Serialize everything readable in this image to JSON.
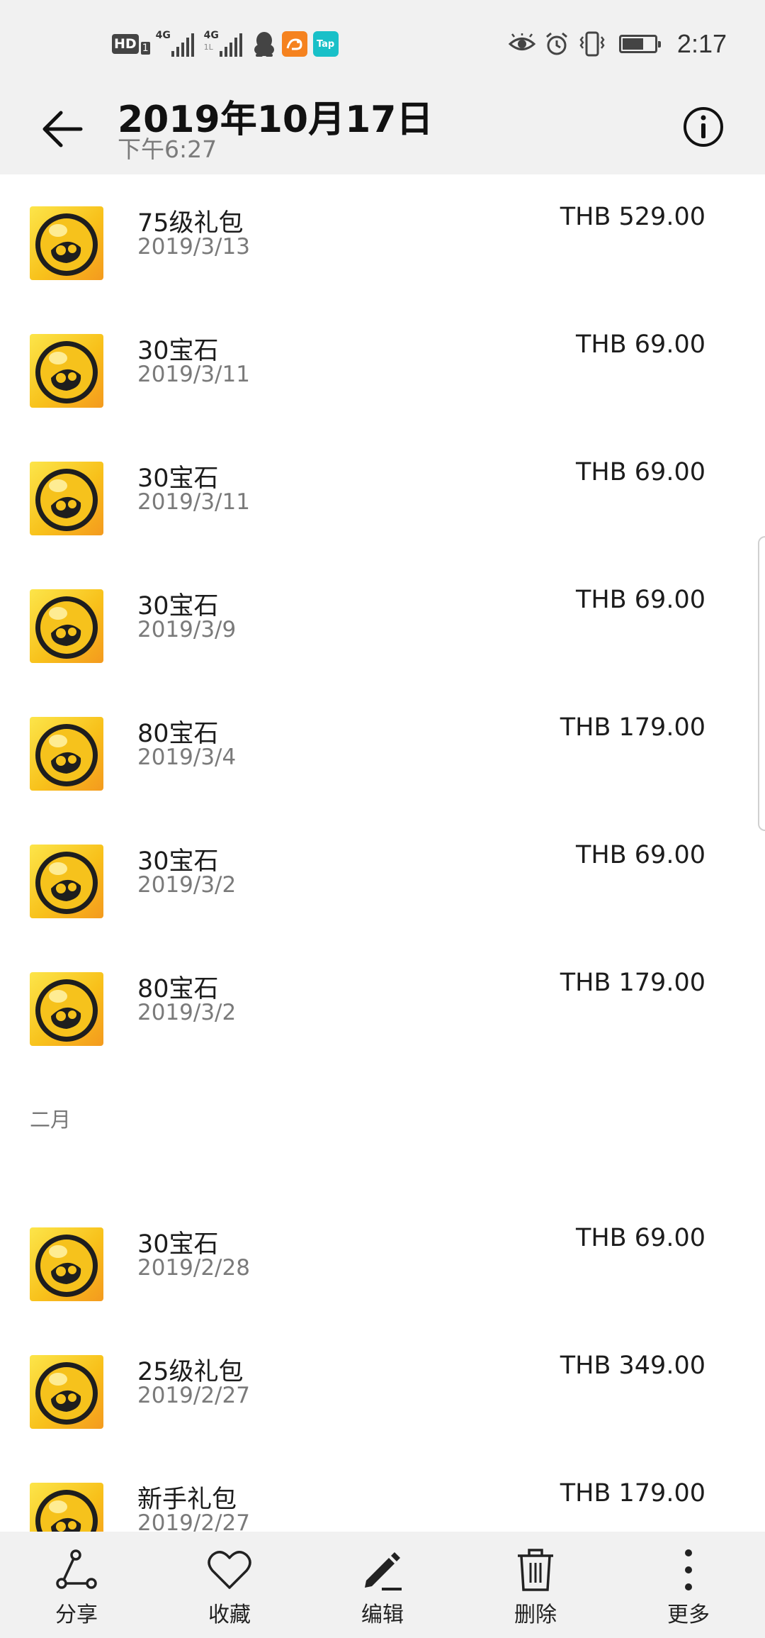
{
  "status_bar": {
    "hd_label": "HD",
    "hd_sub": "1",
    "signal_1_label": "4G",
    "signal_2_label": "4G",
    "signal_2_sub": "1L",
    "tap_app_label": "Tap",
    "time": "2:17"
  },
  "app_bar": {
    "title": "2019年10月17日",
    "subtitle": "下午6:27"
  },
  "list": {
    "items": [
      {
        "name": "75级礼包",
        "date": "2019/3/13",
        "price": "THB 529.00"
      },
      {
        "name": "30宝石",
        "date": "2019/3/11",
        "price": "THB 69.00"
      },
      {
        "name": "30宝石",
        "date": "2019/3/11",
        "price": "THB 69.00"
      },
      {
        "name": "30宝石",
        "date": "2019/3/9",
        "price": "THB 69.00"
      },
      {
        "name": "80宝石",
        "date": "2019/3/4",
        "price": "THB 179.00"
      },
      {
        "name": "30宝石",
        "date": "2019/3/2",
        "price": "THB 69.00"
      },
      {
        "name": "80宝石",
        "date": "2019/3/2",
        "price": "THB 179.00"
      }
    ],
    "section_feb": "二月",
    "feb_items": [
      {
        "name": "30宝石",
        "date": "2019/2/28",
        "price": "THB 69.00"
      },
      {
        "name": "25级礼包",
        "date": "2019/2/27",
        "price": "THB 349.00"
      },
      {
        "name": "新手礼包",
        "date": "2019/2/27",
        "price": "THB 179.00"
      }
    ]
  },
  "bottom_bar": {
    "share": "分享",
    "favorite": "收藏",
    "edit": "编辑",
    "delete": "删除",
    "more": "更多"
  },
  "colors": {
    "bar_bg": "#f1f1f1",
    "icon_yellow": "#fce54a",
    "icon_orange": "#f49a1e"
  },
  "icons": [
    "back-arrow-icon",
    "info-icon",
    "share-icon",
    "heart-icon",
    "pencil-icon",
    "trash-icon",
    "more-vertical-icon",
    "skull-icon"
  ]
}
